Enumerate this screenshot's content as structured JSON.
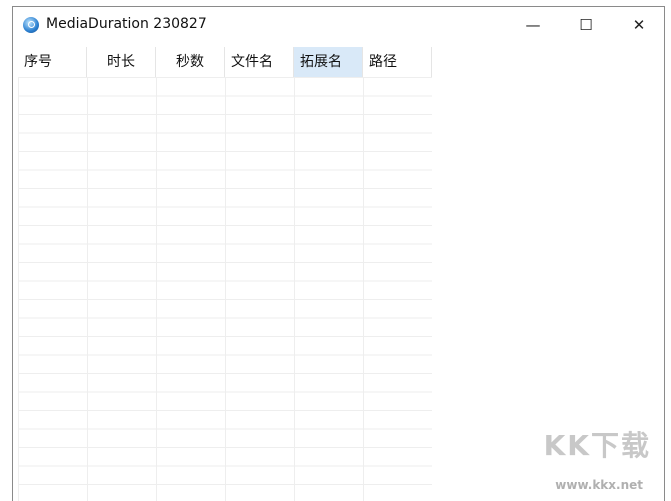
{
  "window": {
    "title": "MediaDuration 230827",
    "minimize": "—",
    "maximize": "☐",
    "close": "✕"
  },
  "columns": [
    {
      "label": "序号"
    },
    {
      "label": "时长"
    },
    {
      "label": "秒数"
    },
    {
      "label": "文件名"
    },
    {
      "label": "拓展名",
      "selected": true
    },
    {
      "label": "路径"
    }
  ],
  "watermark": {
    "logo": "KK下载",
    "url": "www.kkx.net"
  }
}
